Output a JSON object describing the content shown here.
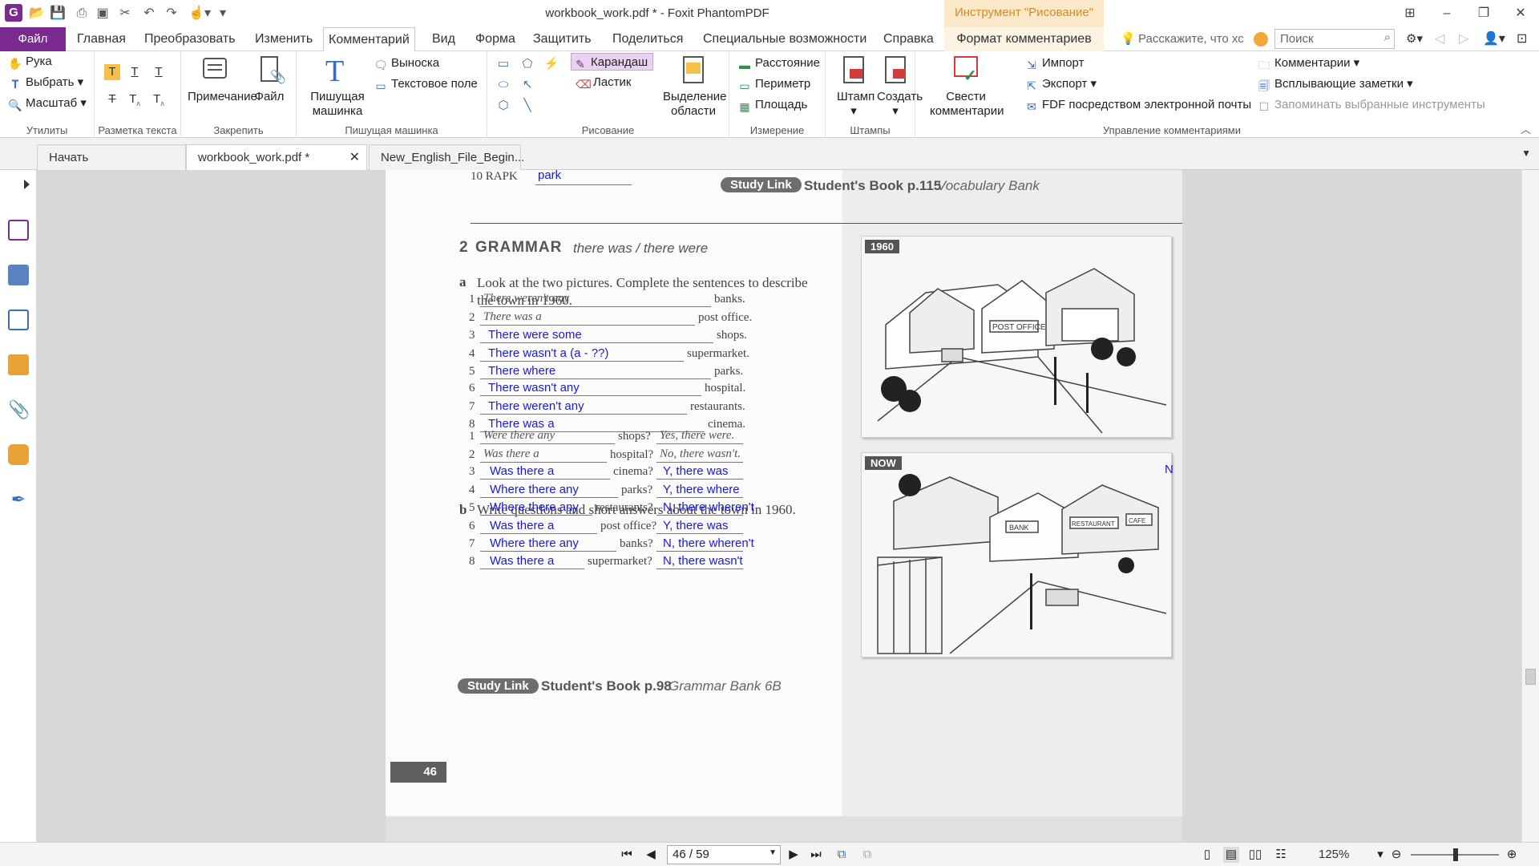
{
  "window": {
    "title": "workbook_work.pdf * - Foxit PhantomPDF",
    "context_tool": "Инструмент \"Рисование\""
  },
  "menu": {
    "file": "Файл",
    "tabs": [
      "Главная",
      "Преобразовать",
      "Изменить",
      "Комментарий",
      "Вид",
      "Форма",
      "Защитить",
      "Поделиться",
      "Специальные возможности",
      "Справка",
      "Формат комментариев"
    ],
    "active_tab": "Комментарий",
    "tell_me": "Расскажите, что хс",
    "search_placeholder": "Поиск"
  },
  "ribbon": {
    "utilities": {
      "label": "Утилиты",
      "hand": "Рука",
      "select": "Выбрать",
      "zoom": "Масштаб"
    },
    "text_markup": {
      "label": "Разметка текста"
    },
    "pin": {
      "label": "Закрепить",
      "note": "Примечание",
      "file": "Файл"
    },
    "typewriter": {
      "label": "Пишущая машинка",
      "typewriter": "Пишущая машинка",
      "callout": "Выноска",
      "textbox": "Текстовое поле"
    },
    "drawing": {
      "label": "Рисование",
      "pencil": "Карандаш",
      "eraser": "Ластик",
      "area_highlight": "Выделение области"
    },
    "measure": {
      "label": "Измерение",
      "distance": "Расстояние",
      "perimeter": "Периметр",
      "area": "Площадь"
    },
    "stamps": {
      "label": "Штампы",
      "stamp": "Штамп",
      "create": "Создать"
    },
    "manage": {
      "label": "Управление комментариями",
      "summarize": "Свести комментарии",
      "import": "Импорт",
      "export": "Экспорт",
      "fdf_email": "FDF посредством электронной почты",
      "comments": "Комментарии",
      "popup_notes": "Всплывающие заметки",
      "remember_tools": "Запоминать выбранные инструменты"
    }
  },
  "doc_tabs": [
    "Начать",
    "workbook_work.pdf *",
    "New_English_File_Begin..."
  ],
  "page": {
    "top_line_num": "10 RAPK",
    "top_answer": "park",
    "study_link_top": {
      "badge": "Study Link",
      "book": "Student's Book p.115",
      "section": "Vocabulary Bank"
    },
    "grammar": {
      "num": "2",
      "title": "GRAMMAR",
      "subtitle": "there was / there were"
    },
    "part_a": {
      "letter": "a",
      "instruction": "Look at the two pictures. Complete the sentences to describe the town in 1960."
    },
    "part_a_items": [
      {
        "n": "1",
        "answer": "There weren't any",
        "example": true,
        "ending": "banks."
      },
      {
        "n": "2",
        "answer": "There was a",
        "example": true,
        "ending": "post office."
      },
      {
        "n": "3",
        "answer": "There were some",
        "example": false,
        "ending": "shops."
      },
      {
        "n": "4",
        "answer": "There wasn't a (a - ??)",
        "example": false,
        "ending": "supermarket."
      },
      {
        "n": "5",
        "answer": "There where",
        "example": false,
        "ending": "parks."
      },
      {
        "n": "6",
        "answer": "There wasn't any",
        "example": false,
        "ending": "hospital."
      },
      {
        "n": "7",
        "answer": "There weren't any",
        "example": false,
        "ending": "restaurants."
      },
      {
        "n": "8",
        "answer": "There was a",
        "example": false,
        "ending": "cinema."
      }
    ],
    "part_b": {
      "letter": "b",
      "instruction": "Write questions and short answers about the town in 1960."
    },
    "part_b_items": [
      {
        "n": "1",
        "q": "Were there any",
        "mid": "shops?",
        "a": "Yes, there were.",
        "example": true
      },
      {
        "n": "2",
        "q": "Was there a",
        "mid": "hospital?",
        "a": "No, there wasn't.",
        "example": true
      },
      {
        "n": "3",
        "q": "Was there a",
        "mid": "cinema?",
        "a": "Y, there was",
        "example": false
      },
      {
        "n": "4",
        "q": "Where there any",
        "mid": "parks?",
        "a": "Y, there where",
        "example": false
      },
      {
        "n": "5",
        "q": "Where there any",
        "mid": "restaurants?",
        "a": "N, there wheren't",
        "example": false
      },
      {
        "n": "6",
        "q": "Was there a",
        "mid": "post office?",
        "a": "Y, there was",
        "example": false
      },
      {
        "n": "7",
        "q": "Where there any",
        "mid": "banks?",
        "a": "N, there wheren't",
        "example": false
      },
      {
        "n": "8",
        "q": "Was there a",
        "mid": "supermarket?",
        "a": "N, there wasn't",
        "example": false
      }
    ],
    "study_link_bottom": {
      "badge": "Study Link",
      "book": "Student's Book p.98",
      "section": "Grammar Bank 6B"
    },
    "pic1_tag": "1960",
    "pic1_signs": [
      "POST OFFICE"
    ],
    "pic2_tag": "NOW",
    "pic2_note": "N",
    "pic2_signs": [
      "BANK",
      "RESTAURANT",
      "CAFE"
    ],
    "page_number": "46"
  },
  "status": {
    "page_field": "46 / 59",
    "zoom": "125%"
  },
  "colors": {
    "brand": "#7b2b8f",
    "context_tab": "#fbe8c8",
    "handwriting": "#1a1ad6"
  }
}
